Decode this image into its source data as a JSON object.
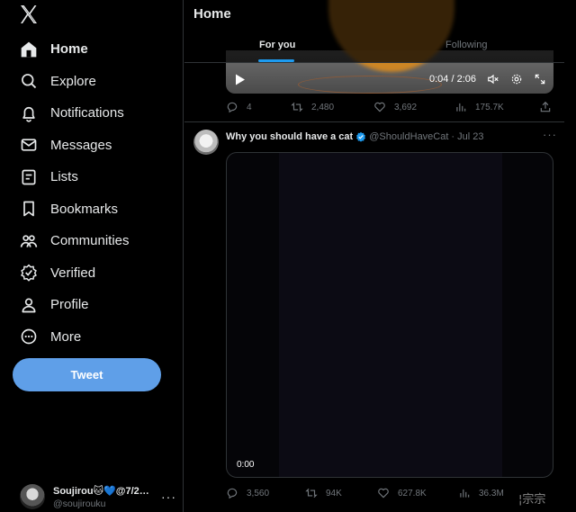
{
  "sidebar": {
    "nav": [
      {
        "label": "Home",
        "icon": "home-icon",
        "active": true
      },
      {
        "label": "Explore",
        "icon": "search-icon"
      },
      {
        "label": "Notifications",
        "icon": "bell-icon"
      },
      {
        "label": "Messages",
        "icon": "mail-icon"
      },
      {
        "label": "Lists",
        "icon": "list-icon"
      },
      {
        "label": "Bookmarks",
        "icon": "bookmark-icon"
      },
      {
        "label": "Communities",
        "icon": "people-icon"
      },
      {
        "label": "Verified",
        "icon": "verified-icon"
      },
      {
        "label": "Profile",
        "icon": "person-icon"
      },
      {
        "label": "More",
        "icon": "more-circle-icon"
      }
    ],
    "tweet_button": "Tweet",
    "account": {
      "name": "Soujirou🐱💙@7/2…",
      "handle": "@soujirouku"
    }
  },
  "header": {
    "title": "Home",
    "tabs": [
      "For you",
      "Following"
    ]
  },
  "tweet1": {
    "video_time": "0:04 / 2:06",
    "stats": {
      "replies": "4",
      "retweets": "2,480",
      "likes": "3,692",
      "views": "175.7K"
    }
  },
  "tweet2": {
    "author_name": "Why you should have a cat",
    "handle": "@ShouldHaveCat",
    "separator": "·",
    "date": "Jul 23",
    "video_time": "0:00",
    "stats": {
      "replies": "3,560",
      "retweets": "94K",
      "likes": "627.8K",
      "views": "36.3M"
    }
  },
  "watermark": "¦宗宗",
  "colors": {
    "accent": "#1d9bf0",
    "tweet_button": "#5f9fe8",
    "muted": "#71767b",
    "border": "#2f3336"
  }
}
